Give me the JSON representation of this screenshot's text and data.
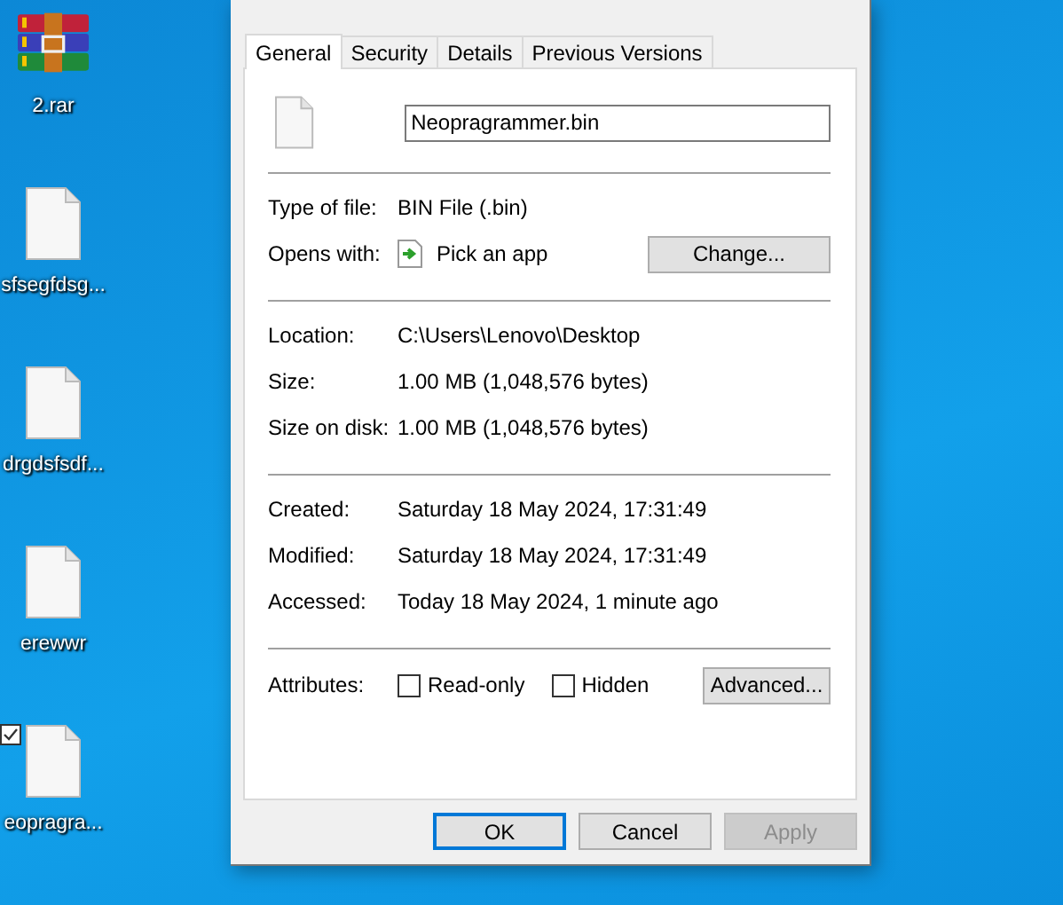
{
  "desktop_icons": [
    {
      "kind": "archive",
      "label": "2.rar",
      "checked": false
    },
    {
      "kind": "file",
      "label": "sfsegfdsg...",
      "checked": false
    },
    {
      "kind": "file",
      "label": "drgdsfsdf...",
      "checked": false
    },
    {
      "kind": "file",
      "label": "erewwr",
      "checked": false
    },
    {
      "kind": "file",
      "label": "eopragra...",
      "checked": true
    }
  ],
  "dialog": {
    "tabs": [
      {
        "label": "General",
        "selected": true
      },
      {
        "label": "Security",
        "selected": false
      },
      {
        "label": "Details",
        "selected": false
      },
      {
        "label": "Previous Versions",
        "selected": false
      }
    ],
    "file_name": "Neopragrammer.bin",
    "sections": [
      [
        {
          "label": "Type of file:",
          "value": "BIN File (.bin)"
        },
        {
          "label": "Opens with:",
          "value": "Pick an app",
          "kind": "app",
          "button": "Change..."
        }
      ],
      [
        {
          "label": "Location:",
          "value": "C:\\Users\\Lenovo\\Desktop"
        },
        {
          "label": "Size:",
          "value": "1.00 MB (1,048,576 bytes)"
        },
        {
          "label": "Size on disk:",
          "value": "1.00 MB (1,048,576 bytes)"
        }
      ],
      [
        {
          "label": "Created:",
          "value": "Saturday 18 May 2024, 17:31:49"
        },
        {
          "label": "Modified:",
          "value": "Saturday 18 May 2024, 17:31:49"
        },
        {
          "label": "Accessed:",
          "value": "Today 18 May 2024, 1 minute ago"
        }
      ]
    ],
    "attributes": {
      "label": "Attributes:",
      "options": [
        {
          "label": "Read-only",
          "checked": false
        },
        {
          "label": "Hidden",
          "checked": false
        }
      ],
      "button": "Advanced..."
    },
    "buttons": [
      {
        "label": "OK",
        "kind": "default",
        "disabled": false
      },
      {
        "label": "Cancel",
        "kind": "normal",
        "disabled": false
      },
      {
        "label": "Apply",
        "kind": "normal",
        "disabled": true
      }
    ]
  }
}
